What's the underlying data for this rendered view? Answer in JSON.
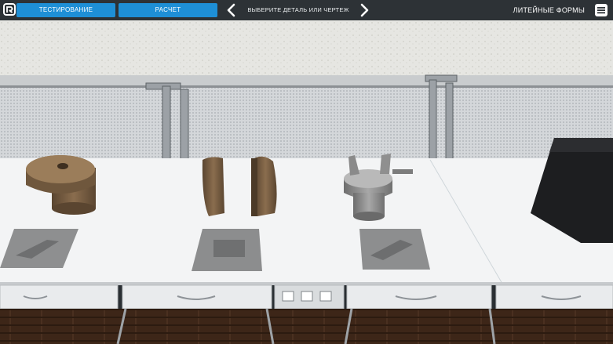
{
  "toolbar": {
    "testing_label": "ТЕСТИРОВАНИЕ",
    "calculation_label": "РАСЧЕТ",
    "selector_label": "ВЫБЕРИТЕ ДЕТАЛЬ ИЛИ ЧЕРТЕЖ",
    "category_label": "ЛИТЕЙНЫЕ ФОРМЫ",
    "icons": {
      "logo": "app-logo-icon",
      "prev": "chevron-left-icon",
      "next": "chevron-right-icon",
      "menu": "hamburger-menu-icon"
    }
  },
  "colors": {
    "toolbar_bg": "#2d3236",
    "button_bg": "#1e8fd6",
    "table_top": "#f2f3f4",
    "wall": "#e7e7e4"
  },
  "scene": {
    "objects": [
      {
        "name": "casting-mold-wood"
      },
      {
        "name": "split-pattern-wood"
      },
      {
        "name": "casting-part-metal"
      },
      {
        "name": "drawing-sheet-1"
      },
      {
        "name": "drawing-sheet-2"
      },
      {
        "name": "drawing-sheet-3"
      },
      {
        "name": "dark-box"
      }
    ]
  }
}
